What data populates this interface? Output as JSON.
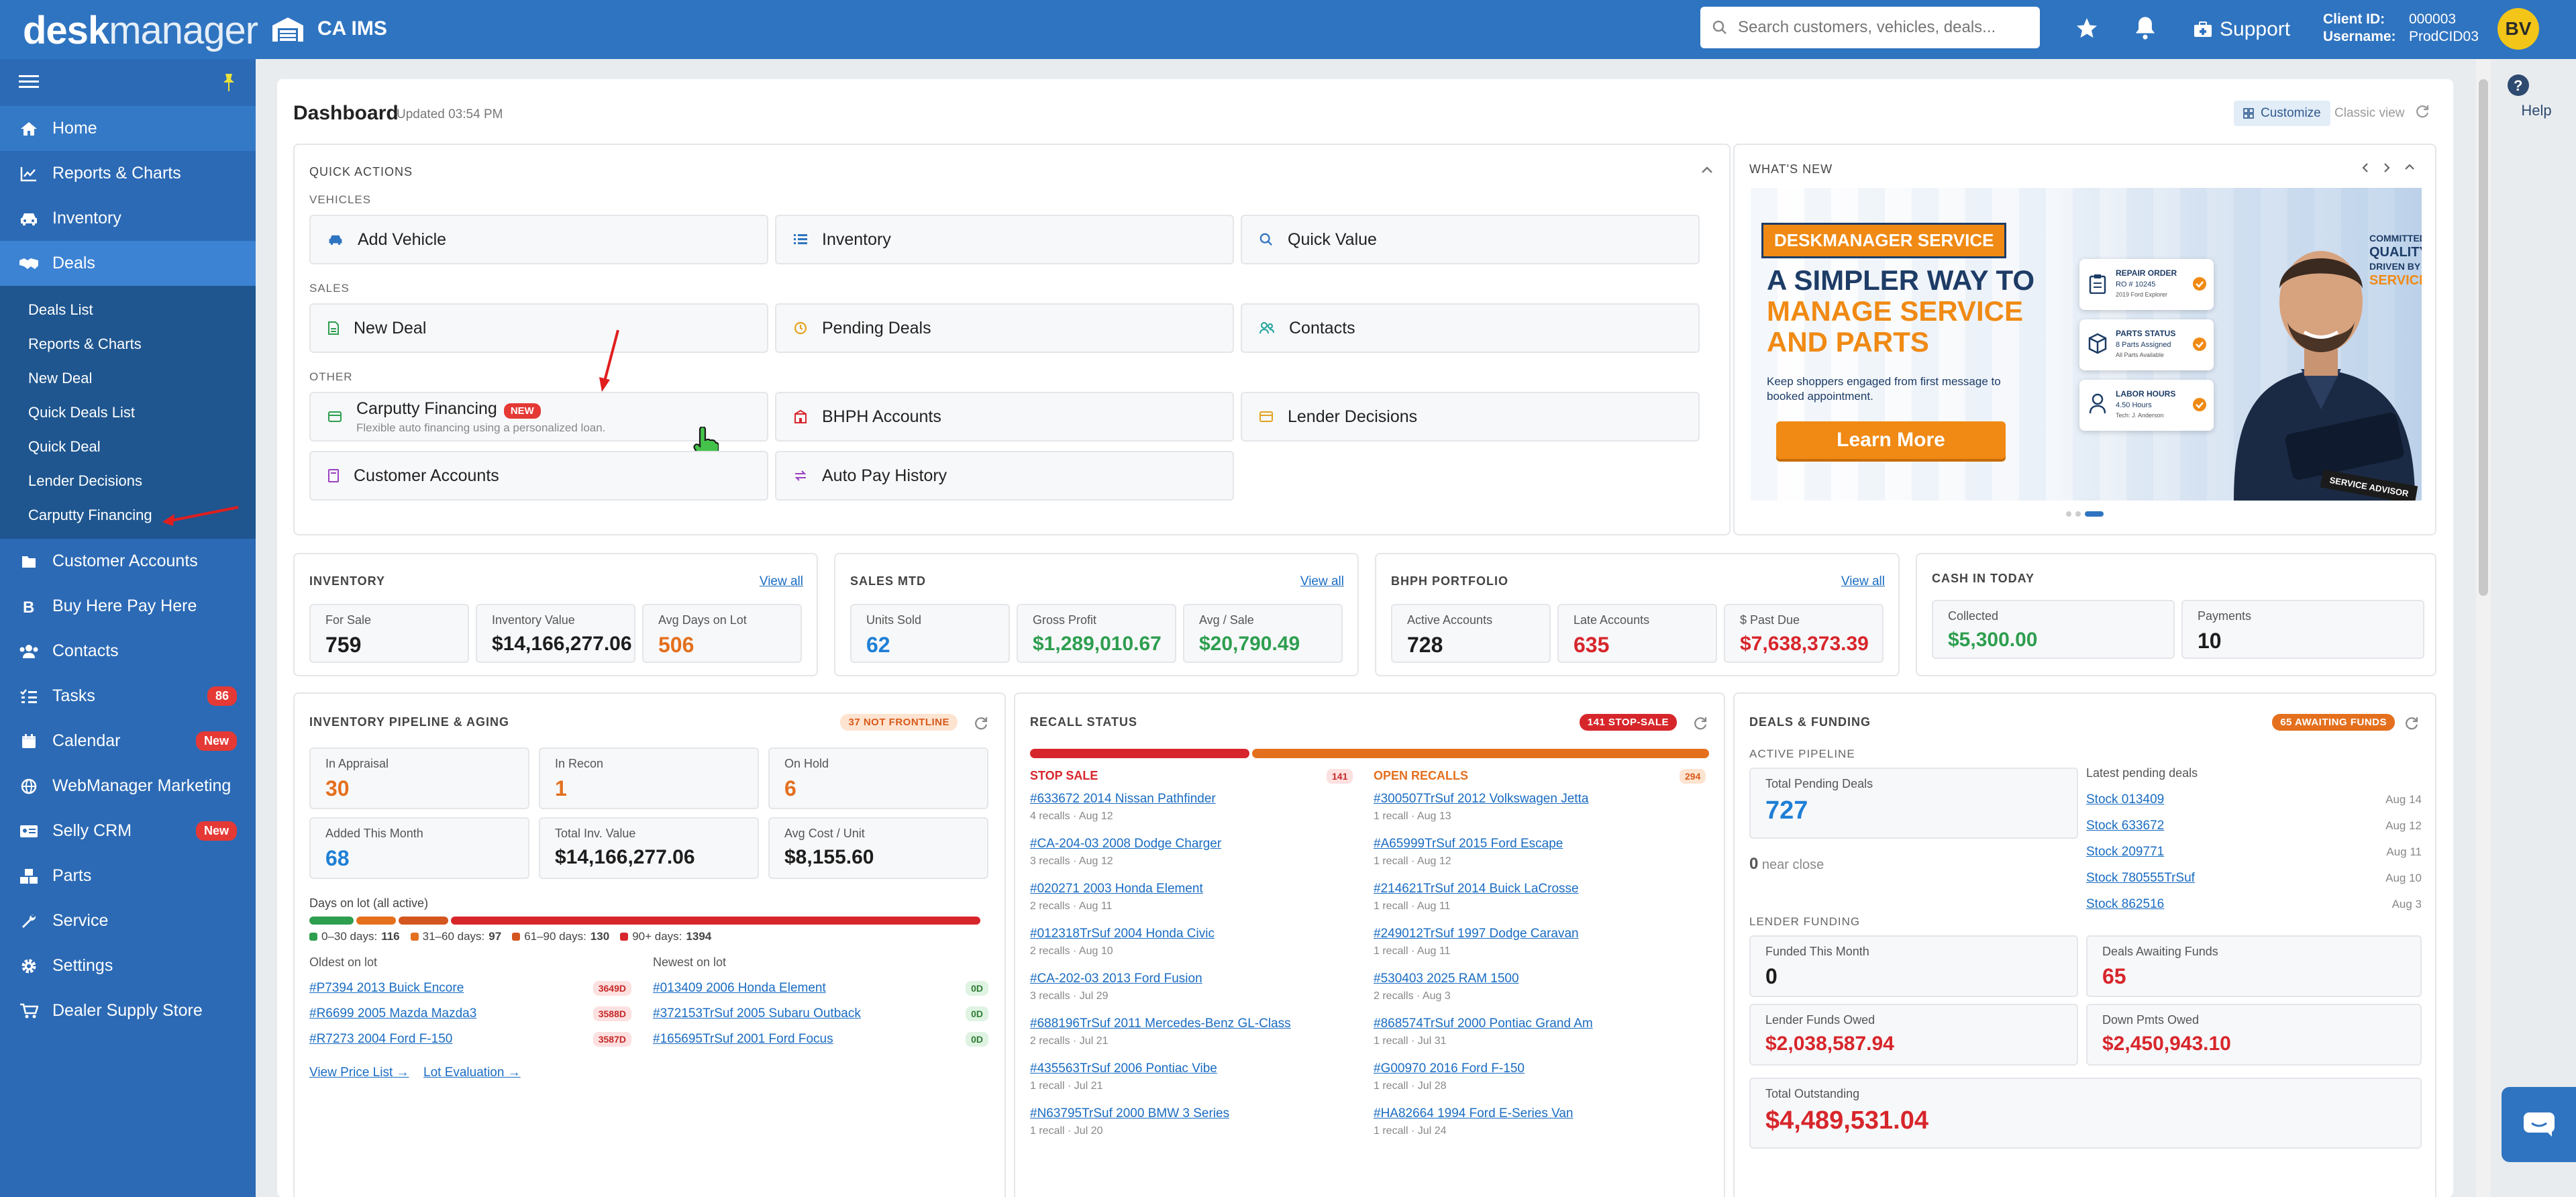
{
  "topbar": {
    "logo_desk": "desk",
    "logo_manager": "manager",
    "app_name": "CA IMS",
    "search_placeholder": "Search customers, vehicles, deals...",
    "support": "Support",
    "client_id_label": "Client ID:",
    "client_id": "000003",
    "username_label": "Username:",
    "username": "ProdCID03",
    "avatar": "BV"
  },
  "sidebar": {
    "items": [
      {
        "label": "Home",
        "icon": "home-icon"
      },
      {
        "label": "Reports & Charts",
        "icon": "chart-icon"
      },
      {
        "label": "Inventory",
        "icon": "car-icon"
      },
      {
        "label": "Deals",
        "icon": "handshake-icon"
      }
    ],
    "sub_items": [
      "Deals List",
      "Reports & Charts",
      "New Deal",
      "Quick Deals List",
      "Quick Deal",
      "Lender Decisions",
      "Carputty Financing"
    ],
    "items2": [
      {
        "label": "Customer Accounts",
        "icon": "folder-icon"
      },
      {
        "label": "Buy Here Pay Here",
        "icon": "bitcoin-icon"
      },
      {
        "label": "Contacts",
        "icon": "users-icon"
      },
      {
        "label": "Tasks",
        "icon": "tasks-icon",
        "badge": "86"
      },
      {
        "label": "Calendar",
        "icon": "calendar-icon",
        "badge": "New"
      },
      {
        "label": "WebManager Marketing",
        "icon": "globe-icon"
      },
      {
        "label": "Selly CRM",
        "icon": "id-card-icon",
        "badge": "New"
      },
      {
        "label": "Parts",
        "icon": "cubes-icon"
      },
      {
        "label": "Service",
        "icon": "wrench-icon"
      },
      {
        "label": "Settings",
        "icon": "gear-icon"
      },
      {
        "label": "Dealer Supply Store",
        "icon": "cart-icon"
      }
    ]
  },
  "help": "Help",
  "dashboard": {
    "title": "Dashboard",
    "updated": "Updated 03:54 PM",
    "customize": "Customize",
    "classic": "Classic view"
  },
  "quick_actions": {
    "title": "QUICK ACTIONS",
    "vehicles": "VEHICLES",
    "sales": "SALES",
    "other": "OTHER",
    "add_vehicle": "Add Vehicle",
    "inventory": "Inventory",
    "quick_value": "Quick Value",
    "new_deal": "New Deal",
    "pending_deals": "Pending Deals",
    "contacts": "Contacts",
    "carputty": "Carputty Financing",
    "carputty_new": "NEW",
    "carputty_sub": "Flexible auto financing using a personalized loan.",
    "bhph": "BHPH Accounts",
    "lender_decisions": "Lender Decisions",
    "customer_accounts": "Customer Accounts",
    "auto_pay": "Auto Pay History"
  },
  "whats_new": {
    "title": "WHAT'S NEW",
    "banner_tag": "DESKMANAGER SERVICE",
    "headline1": "A SIMPLER WAY TO",
    "headline2": "MANAGE SERVICE",
    "headline3": "AND PARTS",
    "body": "Keep shoppers engaged from first message to booked appointment.",
    "cta": "Learn More",
    "card1_title": "REPAIR ORDER",
    "card1_sub": "RO # 10245",
    "card1_sub2": "2019 Ford Explorer",
    "card2_title": "PARTS STATUS",
    "card2_sub": "8 Parts Assigned",
    "card2_sub2": "All Parts Available",
    "card3_title": "LABOR HOURS",
    "card3_sub": "4.50 Hours",
    "card3_sub2": "Tech: J. Anderson",
    "slogan1": "COMMITTED TO",
    "slogan2": "QUALITY.",
    "slogan3": "DRIVEN BY",
    "slogan4": "SERVICE.",
    "sign": "SERVICE ADVISOR"
  },
  "inventory_card": {
    "title": "INVENTORY",
    "view_all": "View all",
    "for_sale_l": "For Sale",
    "for_sale": "759",
    "value_l": "Inventory Value",
    "value": "$14,166,277.06",
    "avg_days_l": "Avg Days on Lot",
    "avg_days": "506"
  },
  "sales_card": {
    "title": "SALES MTD",
    "view_all": "View all",
    "units_l": "Units Sold",
    "units": "62",
    "gross_l": "Gross Profit",
    "gross": "$1,289,010.67",
    "avg_l": "Avg / Sale",
    "avg": "$20,790.49"
  },
  "bhph_card": {
    "title": "BHPH PORTFOLIO",
    "view_all": "View all",
    "active_l": "Active Accounts",
    "active": "728",
    "late_l": "Late Accounts",
    "late": "635",
    "past_l": "$ Past Due",
    "past": "$7,638,373.39"
  },
  "cash_card": {
    "title": "CASH IN TODAY",
    "collected_l": "Collected",
    "collected": "$5,300.00",
    "payments_l": "Payments",
    "payments": "10"
  },
  "pipeline": {
    "title": "INVENTORY PIPELINE & AGING",
    "pill": "37 NOT FRONTLINE",
    "appraisal_l": "In Appraisal",
    "appraisal": "30",
    "recon_l": "In Recon",
    "recon": "1",
    "hold_l": "On Hold",
    "hold": "6",
    "added_l": "Added This Month",
    "added": "68",
    "total_l": "Total Inv. Value",
    "total": "$14,166,277.06",
    "avg_l": "Avg Cost / Unit",
    "avg": "$8,155.60",
    "days_label": "Days on lot (all active)",
    "aging": [
      {
        "label": "0–30 days:",
        "value": 116,
        "color": "#2e9e4f"
      },
      {
        "label": "31–60 days:",
        "value": 97,
        "color": "#e4701e"
      },
      {
        "label": "61–90 days:",
        "value": 130,
        "color": "#d4561f"
      },
      {
        "label": "90+ days:",
        "value": 1394,
        "color": "#d7262b"
      }
    ],
    "oldest_label": "Oldest on lot",
    "newest_label": "Newest on lot",
    "oldest": [
      {
        "name": "#P7394 2013 Buick Encore",
        "tag": "3649D"
      },
      {
        "name": "#R6699 2005 Mazda Mazda3",
        "tag": "3588D"
      },
      {
        "name": "#R7273 2004 Ford F-150",
        "tag": "3587D"
      }
    ],
    "newest": [
      {
        "name": "#013409 2006 Honda Element",
        "tag": "0D"
      },
      {
        "name": "#372153TrSuf 2005 Subaru Outback",
        "tag": "0D"
      },
      {
        "name": "#165695TrSuf 2001 Ford Focus",
        "tag": "0D"
      }
    ],
    "link1": "View Price List →",
    "link2": "Lot Evaluation →"
  },
  "recall": {
    "title": "RECALL STATUS",
    "pill": "141 STOP-SALE",
    "stop_label": "STOP SALE",
    "stop_count": "141",
    "open_label": "OPEN RECALLS",
    "open_count": "294",
    "stop": [
      {
        "name": "#633672 2014 Nissan Pathfinder",
        "sub": "4 recalls · Aug 12"
      },
      {
        "name": "#CA-204-03 2008 Dodge Charger",
        "sub": "3 recalls · Aug 12"
      },
      {
        "name": "#020271 2003 Honda Element",
        "sub": "2 recalls · Aug 11"
      },
      {
        "name": "#012318TrSuf 2004 Honda Civic",
        "sub": "2 recalls · Aug 10"
      },
      {
        "name": "#CA-202-03 2013 Ford Fusion",
        "sub": "3 recalls · Jul 29"
      },
      {
        "name": "#688196TrSuf 2011 Mercedes-Benz GL-Class",
        "sub": "2 recalls · Jul 21"
      },
      {
        "name": "#435563TrSuf 2006 Pontiac Vibe",
        "sub": "1 recall · Jul 21"
      },
      {
        "name": "#N63795TrSuf 2000 BMW 3 Series",
        "sub": "1 recall · Jul 20"
      }
    ],
    "open": [
      {
        "name": "#300507TrSuf 2012 Volkswagen Jetta",
        "sub": "1 recall · Aug 13"
      },
      {
        "name": "#A65999TrSuf 2015 Ford Escape",
        "sub": "1 recall · Aug 12"
      },
      {
        "name": "#214621TrSuf 2014 Buick LaCrosse",
        "sub": "1 recall · Aug 11"
      },
      {
        "name": "#249012TrSuf 1997 Dodge Caravan",
        "sub": "1 recall · Aug 11"
      },
      {
        "name": "#530403 2025 RAM 1500",
        "sub": "2 recalls · Aug 3"
      },
      {
        "name": "#868574TrSuf 2000 Pontiac Grand Am",
        "sub": "1 recall · Jul 31"
      },
      {
        "name": "#G00970 2016 Ford F-150",
        "sub": "1 recall · Jul 28"
      },
      {
        "name": "#HA82664 1994 Ford E-Series Van",
        "sub": "1 recall · Jul 24"
      }
    ]
  },
  "funding": {
    "title": "DEALS & FUNDING",
    "pill": "65 AWAITING FUNDS",
    "active_pipeline": "ACTIVE PIPELINE",
    "pending_l": "Total Pending Deals",
    "pending": "727",
    "near_close": "0",
    "near_close_l": "near close",
    "latest_label": "Latest pending deals",
    "latest": [
      {
        "name": "Stock 013409",
        "date": "Aug 14"
      },
      {
        "name": "Stock 633672",
        "date": "Aug 12"
      },
      {
        "name": "Stock 209771",
        "date": "Aug 11"
      },
      {
        "name": "Stock 780555TrSuf",
        "date": "Aug 10"
      },
      {
        "name": "Stock 862516",
        "date": "Aug 3"
      }
    ],
    "lender_label": "LENDER FUNDING",
    "funded_l": "Funded This Month",
    "funded": "0",
    "awaiting_l": "Deals Awaiting Funds",
    "awaiting": "65",
    "owed_l": "Lender Funds Owed",
    "owed": "$2,038,587.94",
    "down_l": "Down Pmts Owed",
    "down": "$2,450,943.10",
    "outstanding_l": "Total Outstanding",
    "outstanding": "$4,489,531.04"
  }
}
